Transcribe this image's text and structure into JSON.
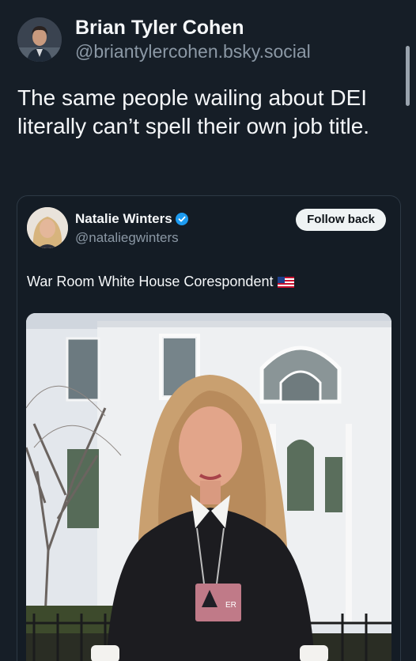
{
  "post": {
    "author_name": "Brian Tyler Cohen",
    "author_handle": "@briantylercohen.bsky.social",
    "text": "The same people wailing about DEI literally can’t spell their own job title.",
    "avatar_icon": "person-avatar-icon"
  },
  "quoted": {
    "author_name": "Natalie Winters",
    "author_handle": "@nataliegwinters",
    "follow_label": "Follow back",
    "text": "War Room White House Corespondent",
    "verified_icon": "verified-badge-icon",
    "flag_icon": "us-flag-icon",
    "badge_text_1": "ER",
    "colors": {
      "verified": "#1d9bf0",
      "background": "#161e27",
      "muted": "#8b98a5"
    }
  }
}
